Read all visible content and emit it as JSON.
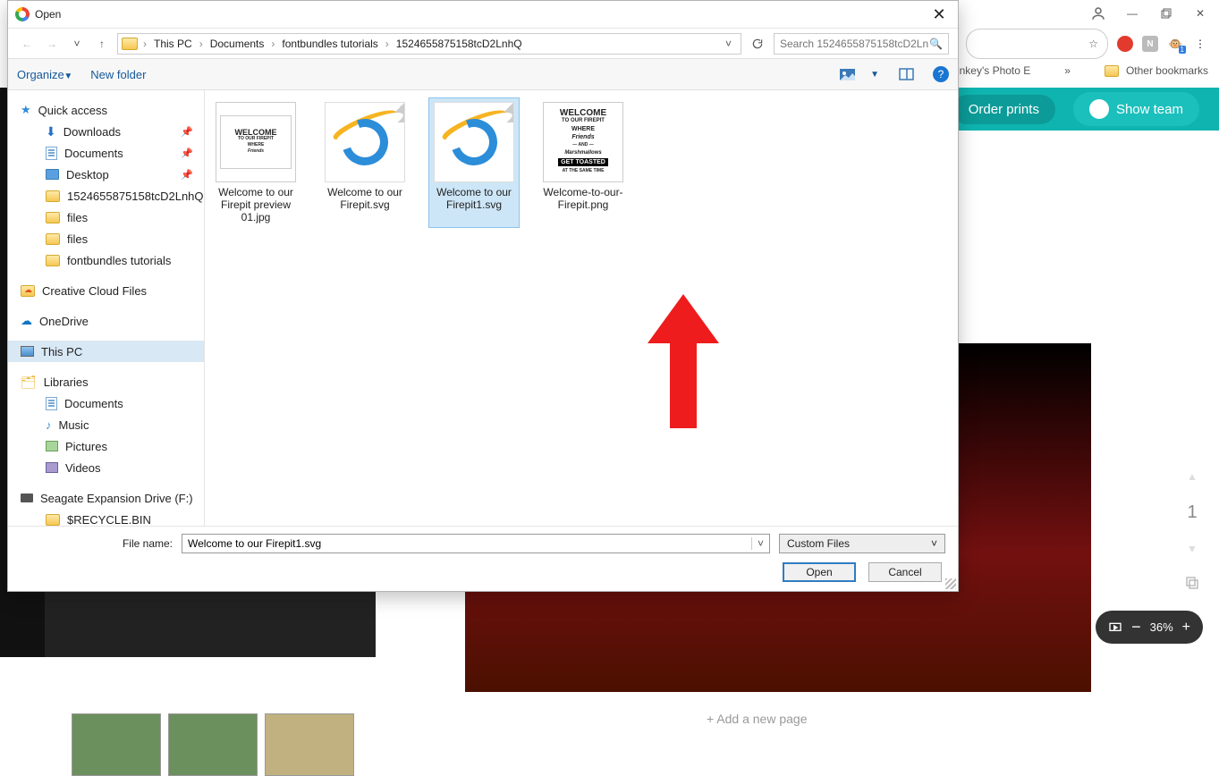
{
  "dialog": {
    "title": "Open",
    "breadcrumb": {
      "segments": [
        "This PC",
        "Documents",
        "fontbundles tutorials",
        "1524655875158tcD2LnhQ"
      ]
    },
    "search_placeholder": "Search 1524655875158tcD2Ln",
    "toolbar": {
      "organize": "Organize",
      "new_folder": "New folder"
    },
    "sidebar": {
      "quick_access": "Quick access",
      "downloads": "Downloads",
      "documents": "Documents",
      "desktop": "Desktop",
      "folder_hash": "1524655875158tcD2LnhQ",
      "files1": "files",
      "files2": "files",
      "fb_tutorials": "fontbundles tutorials",
      "ccf": "Creative Cloud Files",
      "onedrive": "OneDrive",
      "this_pc": "This PC",
      "libraries": "Libraries",
      "lib_documents": "Documents",
      "lib_music": "Music",
      "lib_pictures": "Pictures",
      "lib_videos": "Videos",
      "seagate": "Seagate Expansion Drive (F:)",
      "recycle": "$RECYCLE.BIN"
    },
    "files": [
      {
        "name": "Welcome to our Firepit preview 01.jpg",
        "kind": "jpg"
      },
      {
        "name": "Welcome to our Firepit.svg",
        "kind": "ie"
      },
      {
        "name": "Welcome to our Firepit1.svg",
        "kind": "ie",
        "selected": true
      },
      {
        "name": "Welcome-to-our-Firepit.png",
        "kind": "png"
      }
    ],
    "thumb_text": {
      "welcome": "WELCOME",
      "line2": "TO OUR FIREPIT",
      "line3": "WHERE",
      "line4": "Friends",
      "line5": "— AND —",
      "line6": "Marshmallows",
      "line7": "GET TOASTED",
      "line8": "AT THE SAME TIME"
    },
    "footer": {
      "file_name_label": "File name:",
      "file_name_value": "Welcome to our Firepit1.svg",
      "file_type": "Custom Files",
      "open": "Open",
      "cancel": "Cancel"
    }
  },
  "browser": {
    "bookmark_truncated": "nkey's Photo E",
    "more": "»",
    "other_bookmarks": "Other bookmarks",
    "order_prints": "Order prints",
    "show_team": "Show team",
    "add_page": "+ Add a new page",
    "page_number": "1",
    "zoom": {
      "percent": "36%"
    }
  }
}
